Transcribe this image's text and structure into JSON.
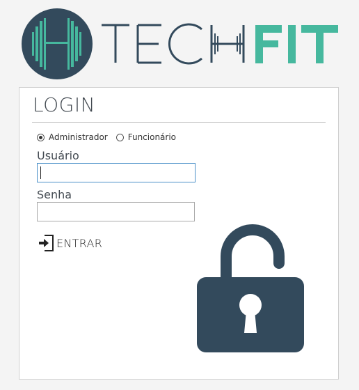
{
  "brand": {
    "logo_letter": "H",
    "name_part1": "TECH",
    "name_part2": "FIT",
    "colors": {
      "dark": "#334a5c",
      "accent": "#46b89e"
    }
  },
  "login": {
    "title": "LOGIN",
    "roles": [
      {
        "label": "Administrador",
        "checked": true
      },
      {
        "label": "Funcionário",
        "checked": false
      }
    ],
    "user_label": "Usuário",
    "user_value": "",
    "password_label": "Senha",
    "password_value": "",
    "submit_label": "ENTRAR",
    "submit_icon": "sign-in-icon",
    "decoration_icon": "unlocked-padlock-icon"
  }
}
